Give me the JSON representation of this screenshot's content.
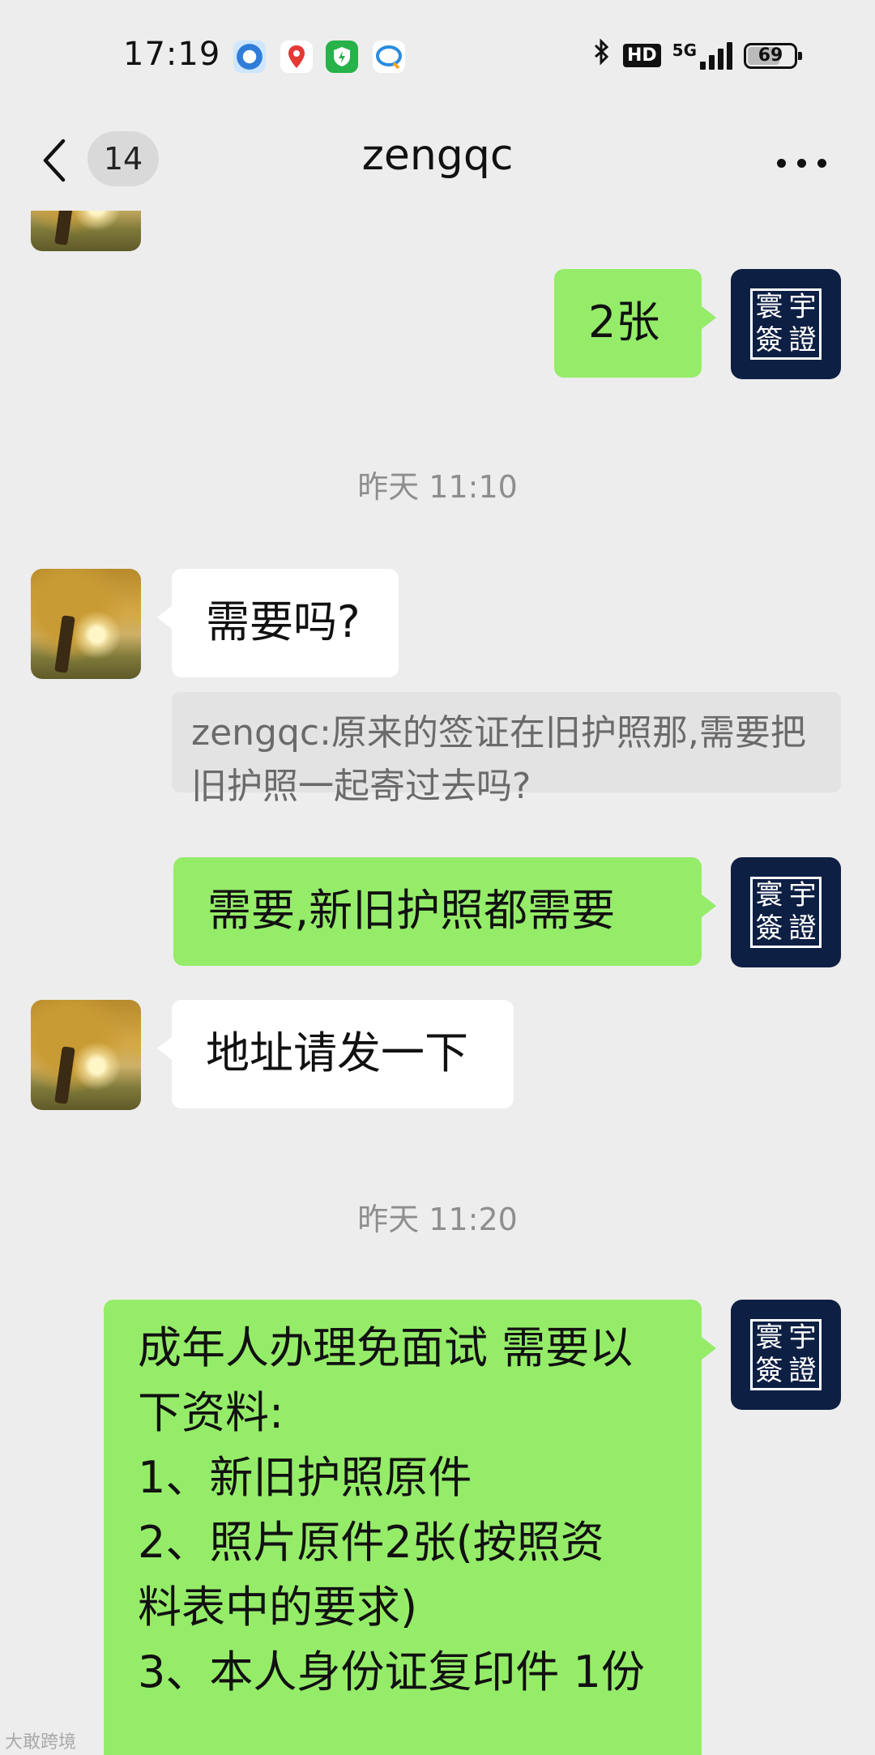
{
  "status_bar": {
    "time": "17:19",
    "network": "5G",
    "hd": "HD",
    "battery": "69",
    "battery_level": 0.69,
    "icons": [
      "browser-icon",
      "baidu-map-icon",
      "security-shield-icon",
      "chat-app-icon",
      "bluetooth-icon"
    ]
  },
  "nav": {
    "unread_count": "14",
    "title": "zengqc"
  },
  "messages": {
    "m1_text": "2张",
    "ts1": "昨天 11:10",
    "m2_text": "需要吗?",
    "quote_text": "zengqc:原来的签证在旧护照那,需要把旧护照一起寄过去吗?",
    "m3_text": "需要,新旧护照都需要",
    "m4_text": "地址请发一下",
    "ts2": "昨天 11:20",
    "m5_lines": [
      "成年人办理免面试 需要以",
      "下资料:",
      "1、新旧护照原件",
      "2、照片原件2张(按照资",
      "料表中的要求)",
      "3、本人身份证复印件 1份"
    ]
  },
  "logo_chars": [
    "寰",
    "宇",
    "簽",
    "證"
  ],
  "watermark": "大敢跨境",
  "colors": {
    "background": "#ededed",
    "outgoing_bubble": "#95ec69",
    "incoming_bubble": "#ffffff",
    "logo_bg": "#0e1f44"
  }
}
